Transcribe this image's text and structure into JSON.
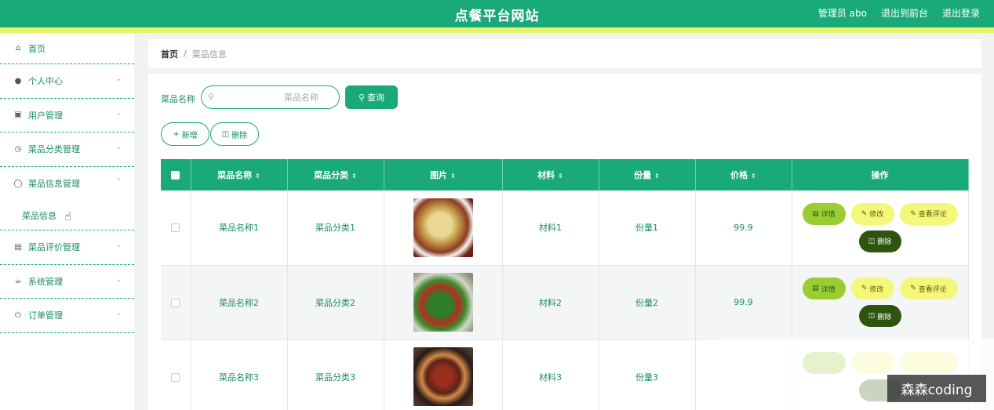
{
  "header": {
    "title": "点餐平台网站",
    "admin_label": "管理员 abo",
    "front_link": "退出到前台",
    "logout_link": "退出登录"
  },
  "sidebar": {
    "items": [
      {
        "label": "首页",
        "icon": "home-icon"
      },
      {
        "label": "个人中心",
        "icon": "user-icon"
      },
      {
        "label": "用户管理",
        "icon": "monitor-icon"
      },
      {
        "label": "菜品分类管理",
        "icon": "clock-icon"
      },
      {
        "label": "菜品信息管理",
        "icon": "compass-icon"
      },
      {
        "label": "菜品评价管理",
        "icon": "chart-icon"
      },
      {
        "label": "系统管理",
        "icon": "tea-icon"
      },
      {
        "label": "订单管理",
        "icon": "power-icon"
      }
    ],
    "sub_item": "菜品信息"
  },
  "breadcrumb": {
    "home": "首页",
    "separator": "/",
    "current": "菜品信息"
  },
  "search": {
    "label": "菜品名称",
    "placeholder": "菜品名称",
    "button": "查询"
  },
  "actions": {
    "add": "新增",
    "delete": "删除"
  },
  "table": {
    "columns": [
      "菜品名称",
      "菜品分类",
      "图片",
      "材料",
      "份量",
      "价格",
      "操作"
    ],
    "rows": [
      {
        "name": "菜品名称1",
        "category": "菜品分类1",
        "material": "材料1",
        "portion": "份量1",
        "price": "99.9"
      },
      {
        "name": "菜品名称2",
        "category": "菜品分类2",
        "material": "材料2",
        "portion": "份量2",
        "price": "99.9"
      },
      {
        "name": "菜品名称3",
        "category": "菜品分类3",
        "material": "材料3",
        "portion": "份量3",
        "price": ""
      }
    ],
    "op_labels": {
      "detail": "详情",
      "edit": "修改",
      "review": "查看评论",
      "delete": "删除"
    }
  },
  "watermark": "森森coding",
  "colors": {
    "primary": "#1aaa7a",
    "accent_bar": "#e8f36a",
    "detail_btn": "#9acd32",
    "edit_btn": "#f5f77a",
    "delete_btn": "#2f5410"
  }
}
